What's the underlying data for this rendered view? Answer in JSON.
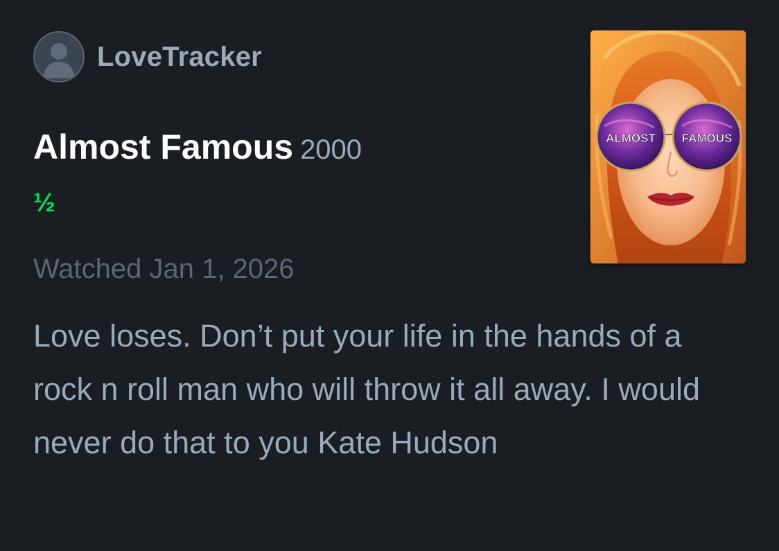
{
  "review": {
    "author": {
      "username": "LoveTracker",
      "avatar_icon": "person-silhouette-icon"
    },
    "film": {
      "title": "Almost Famous",
      "year": "2000"
    },
    "rating": {
      "display": "½",
      "stars": 0.5,
      "max_stars": 5
    },
    "watched": "Watched Jan 1, 2026",
    "text": "Love loses. Don’t put your life in the hands of a rock n roll man who will throw it all away. I would never do that to you Kate Hudson",
    "poster": {
      "lens_left_text": "ALMOST",
      "lens_right_text": "FAMOUS"
    }
  },
  "colors": {
    "background": "#1a1d22",
    "username": "#99aabb",
    "title": "#ffffff",
    "year": "#99aabb",
    "rating": "#00e054",
    "watched": "#5b6677",
    "review_text": "#99aabb"
  }
}
